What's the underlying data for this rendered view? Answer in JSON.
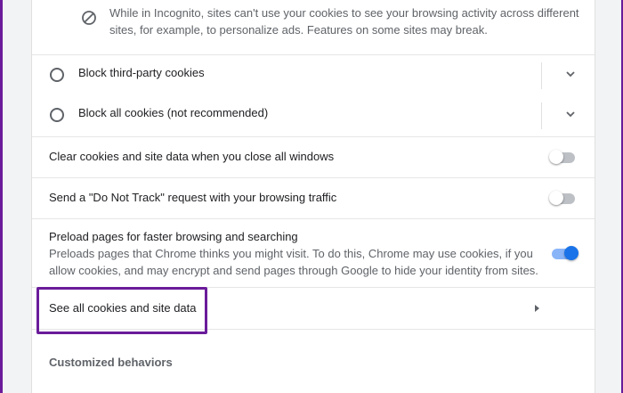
{
  "incognito_info": {
    "icon": "block-icon",
    "text": "While in Incognito, sites can't use your cookies to see your browsing activity across different sites, for example, to personalize ads. Features on some sites may break."
  },
  "radio_options": [
    {
      "label": "Block third-party cookies",
      "selected": false
    },
    {
      "label": "Block all cookies (not recommended)",
      "selected": false
    }
  ],
  "settings": {
    "clear_on_close": {
      "label": "Clear cookies and site data when you close all windows",
      "enabled": false
    },
    "do_not_track": {
      "label": "Send a \"Do Not Track\" request with your browsing traffic",
      "enabled": false
    },
    "preload": {
      "label": "Preload pages for faster browsing and searching",
      "description": "Preloads pages that Chrome thinks you might visit. To do this, Chrome may use cookies, if you allow cookies, and may encrypt and send pages through Google to hide your identity from sites.",
      "enabled": true
    }
  },
  "see_all": {
    "label": "See all cookies and site data",
    "icon": "chevron-right-icon"
  },
  "customized_behaviors": {
    "title": "Customized behaviors"
  },
  "colors": {
    "accent": "#1a73e8",
    "highlight_border": "#6a1b9a"
  }
}
